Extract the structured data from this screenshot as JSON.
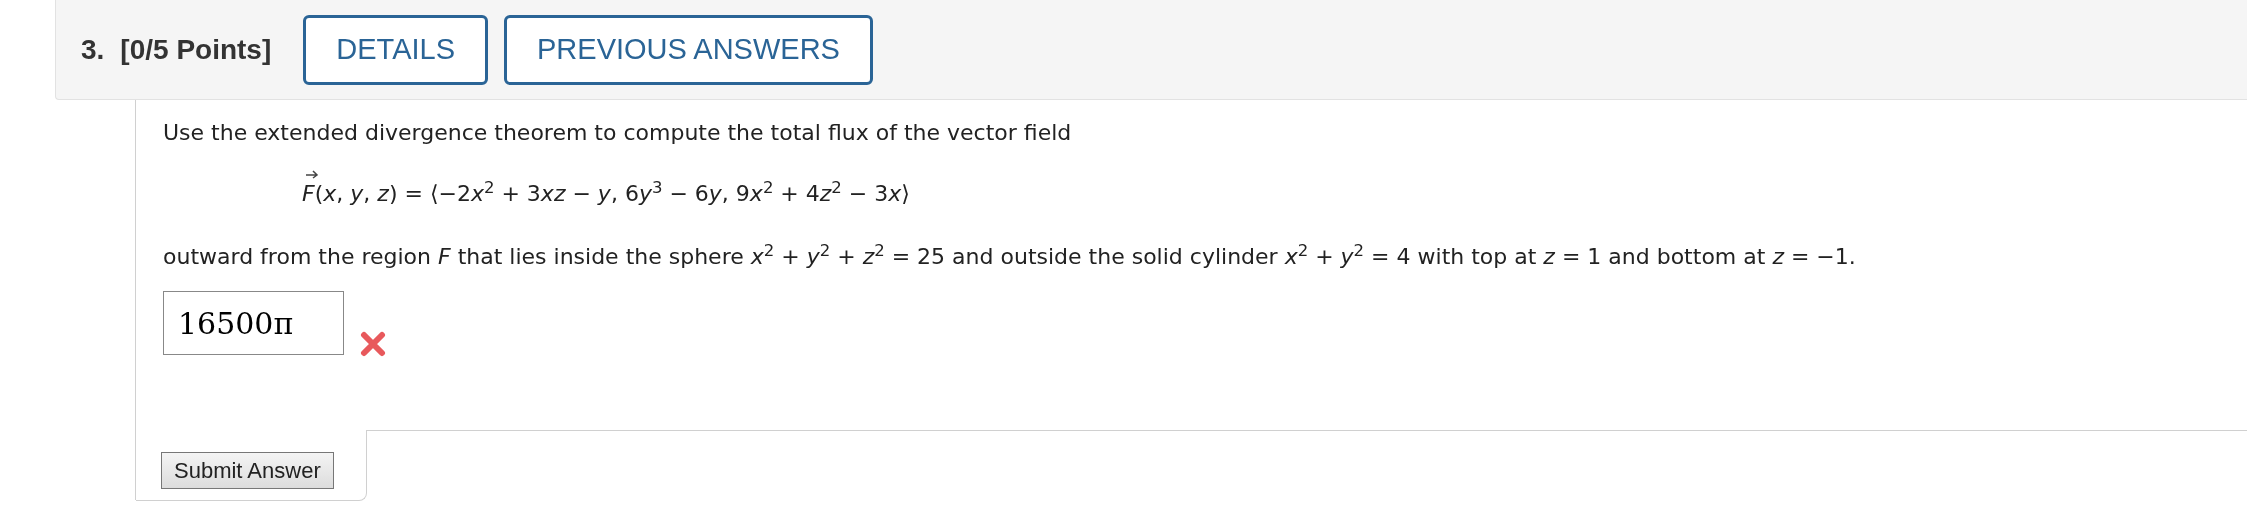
{
  "question": {
    "number": "3.",
    "points": "[0/5 Points]",
    "buttons": [
      "DETAILS",
      "PREVIOUS ANSWERS"
    ]
  },
  "prompt": "Use the extended divergence theorem to compute the total flux of the vector field",
  "formula": {
    "vector_symbol": "F",
    "rest": [
      {
        "kind": "plain",
        "text": "("
      },
      {
        "kind": "var",
        "text": "x"
      },
      {
        "kind": "plain",
        "text": ", "
      },
      {
        "kind": "var",
        "text": "y"
      },
      {
        "kind": "plain",
        "text": ", "
      },
      {
        "kind": "var",
        "text": "z"
      },
      {
        "kind": "plain",
        "text": ") = ⟨−2"
      },
      {
        "kind": "var",
        "text": "x"
      },
      {
        "kind": "sup",
        "text": "2"
      },
      {
        "kind": "plain",
        "text": " + 3"
      },
      {
        "kind": "var",
        "text": "xz"
      },
      {
        "kind": "plain",
        "text": " − "
      },
      {
        "kind": "var",
        "text": "y"
      },
      {
        "kind": "plain",
        "text": ", 6"
      },
      {
        "kind": "var",
        "text": "y"
      },
      {
        "kind": "sup",
        "text": "3"
      },
      {
        "kind": "plain",
        "text": " − 6"
      },
      {
        "kind": "var",
        "text": "y"
      },
      {
        "kind": "plain",
        "text": ", 9"
      },
      {
        "kind": "var",
        "text": "x"
      },
      {
        "kind": "sup",
        "text": "2"
      },
      {
        "kind": "plain",
        "text": " + 4"
      },
      {
        "kind": "var",
        "text": "z"
      },
      {
        "kind": "sup",
        "text": "2"
      },
      {
        "kind": "plain",
        "text": " − 3"
      },
      {
        "kind": "var",
        "text": "x"
      },
      {
        "kind": "plain",
        "text": "⟩"
      }
    ]
  },
  "region_text": "outward from the region *F* that lies inside the sphere *x*$^{2}$ + *y*$^{2}$ + *z*$^{2}$ = 25 and outside the solid cylinder *x*$^{2}$ + *y*$^{2}$ = 4 with top at *z* = 1 and bottom at *z* = −1.",
  "answer": {
    "value": "16500π",
    "correct": false
  },
  "submit_button": "Submit Answer"
}
